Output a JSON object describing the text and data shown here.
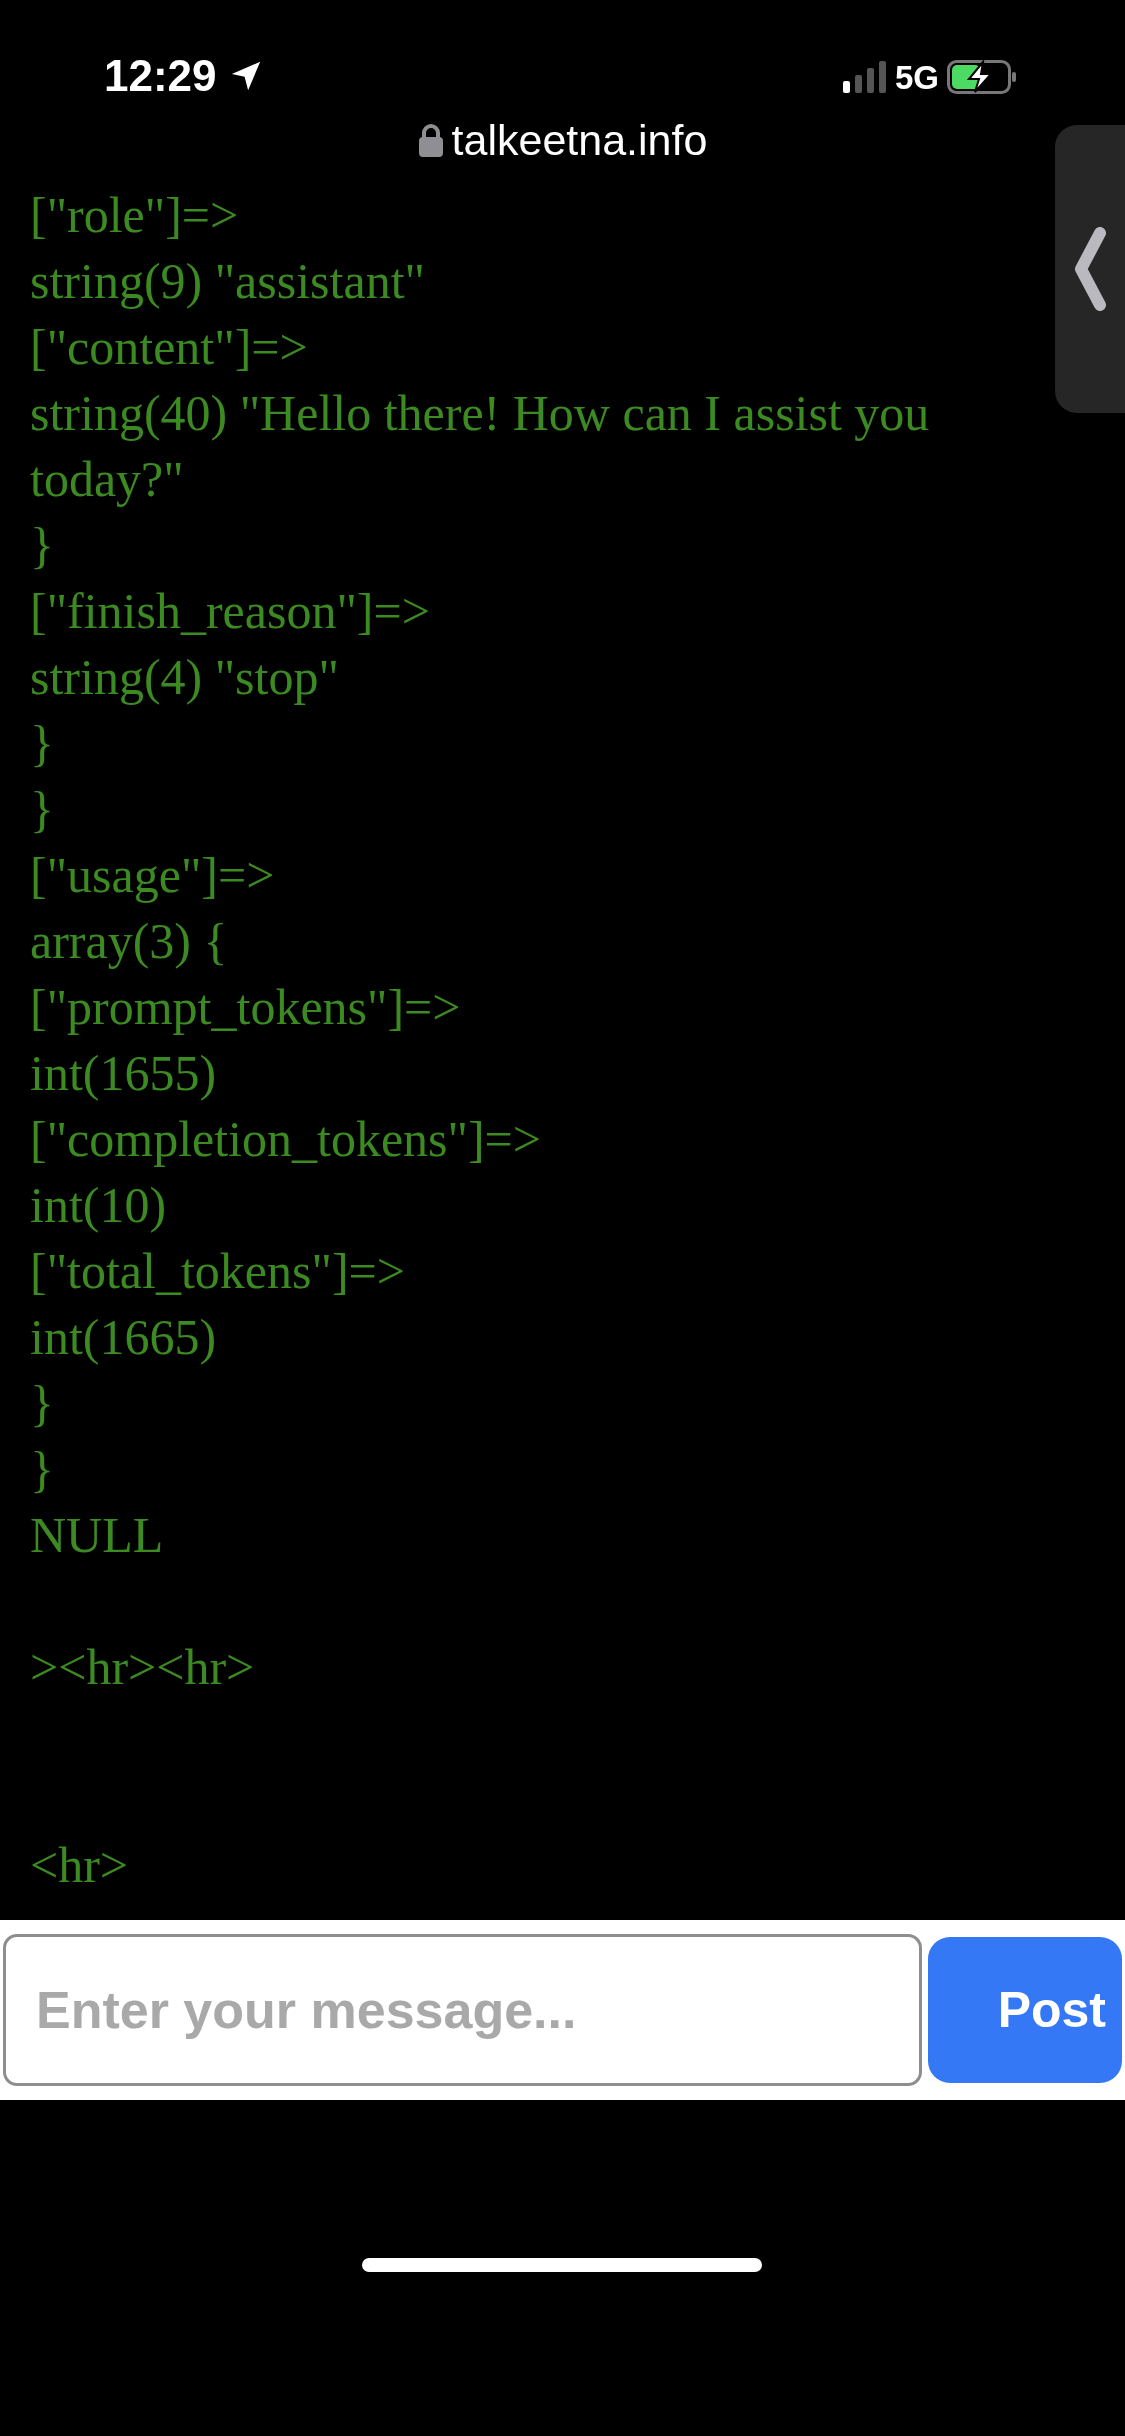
{
  "status_bar": {
    "time": "12:29",
    "network": "5G"
  },
  "address_bar": {
    "url": "talkeetna.info"
  },
  "output": [
    {
      "kind": "text",
      "text": "[\"role\"]=>"
    },
    {
      "kind": "text",
      "text": "string(9) \"assistant\""
    },
    {
      "kind": "text",
      "text": "[\"content\"]=>"
    },
    {
      "kind": "text",
      "text": "string(40) \"Hello there! How can I assist you today?\""
    },
    {
      "kind": "text",
      "text": "}"
    },
    {
      "kind": "text",
      "text": "[\"finish_reason\"]=>"
    },
    {
      "kind": "text",
      "text": "string(4) \"stop\""
    },
    {
      "kind": "text",
      "text": "}"
    },
    {
      "kind": "text",
      "text": "}"
    },
    {
      "kind": "text",
      "text": "[\"usage\"]=>"
    },
    {
      "kind": "text",
      "text": "array(3) {"
    },
    {
      "kind": "text",
      "text": "[\"prompt_tokens\"]=>"
    },
    {
      "kind": "text",
      "text": "int(1655)"
    },
    {
      "kind": "text",
      "text": "[\"completion_tokens\"]=>"
    },
    {
      "kind": "text",
      "text": "int(10)"
    },
    {
      "kind": "text",
      "text": "[\"total_tokens\"]=>"
    },
    {
      "kind": "text",
      "text": "int(1665)"
    },
    {
      "kind": "text",
      "text": "}"
    },
    {
      "kind": "text",
      "text": "}"
    },
    {
      "kind": "text",
      "text": "NULL"
    },
    {
      "kind": "blank"
    },
    {
      "kind": "text",
      "text": "><hr><hr>"
    },
    {
      "kind": "blank"
    },
    {
      "kind": "blank"
    },
    {
      "kind": "text",
      "text": "<hr>"
    }
  ],
  "composer": {
    "placeholder": "Enter your message...",
    "button": "Post"
  }
}
